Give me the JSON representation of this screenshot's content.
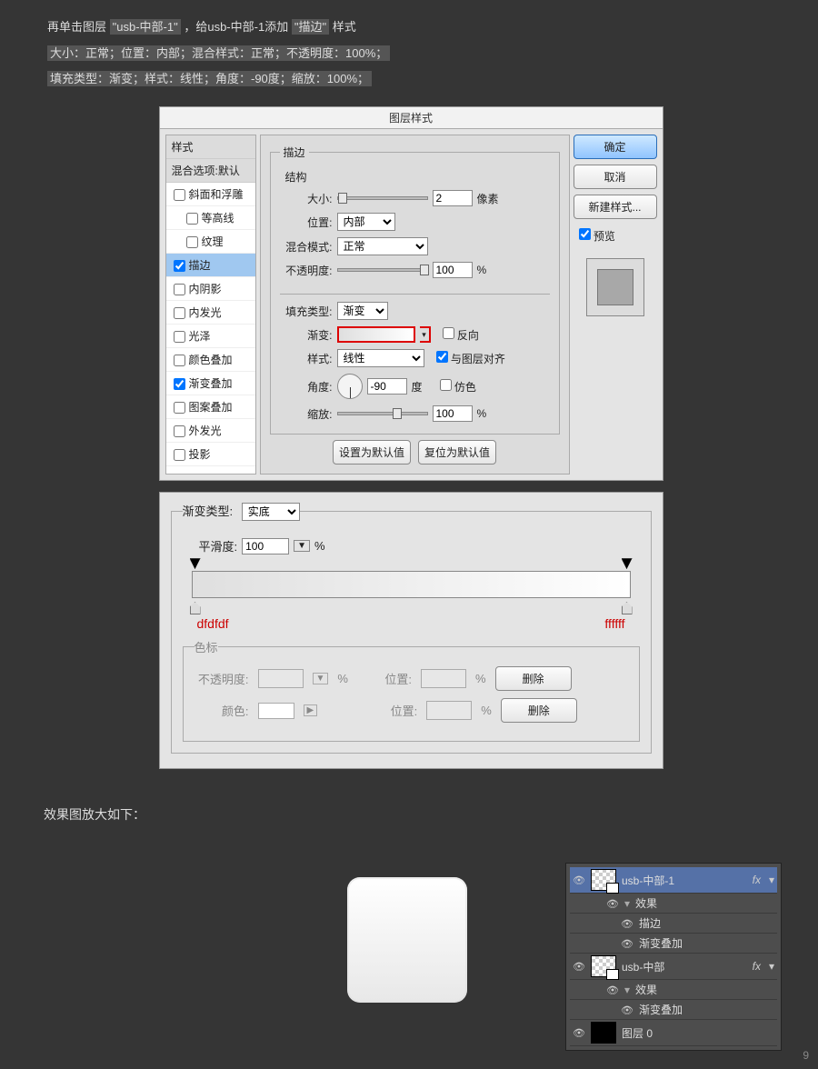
{
  "instructions": {
    "line1_a": "再单击图层",
    "line1_b": "\"usb-中部-1\"",
    "line1_c": "，给usb-中部-1添加",
    "line1_d": "\"描边\"",
    "line1_e": "样式",
    "line2": "大小：正常；位置：内部；混合样式：正常；不透明度：100%；",
    "line3": "填充类型：渐变；样式：线性；角度：-90度；缩放：100%；"
  },
  "dialog": {
    "title": "图层样式",
    "styles_header": "样式",
    "blend_header": "混合选项:默认",
    "style_items": [
      {
        "label": "斜面和浮雕",
        "checked": false,
        "indent": 0
      },
      {
        "label": "等高线",
        "checked": false,
        "indent": 1
      },
      {
        "label": "纹理",
        "checked": false,
        "indent": 1
      },
      {
        "label": "描边",
        "checked": true,
        "indent": 0,
        "selected": true
      },
      {
        "label": "内阴影",
        "checked": false,
        "indent": 0
      },
      {
        "label": "内发光",
        "checked": false,
        "indent": 0
      },
      {
        "label": "光泽",
        "checked": false,
        "indent": 0
      },
      {
        "label": "颜色叠加",
        "checked": false,
        "indent": 0
      },
      {
        "label": "渐变叠加",
        "checked": true,
        "indent": 0
      },
      {
        "label": "图案叠加",
        "checked": false,
        "indent": 0
      },
      {
        "label": "外发光",
        "checked": false,
        "indent": 0
      },
      {
        "label": "投影",
        "checked": false,
        "indent": 0
      }
    ],
    "stroke_legend": "描边",
    "struct_legend": "结构",
    "size_label": "大小:",
    "size_value": "2",
    "size_unit": "像素",
    "position_label": "位置:",
    "position_value": "内部",
    "blend_label": "混合模式:",
    "blend_value": "正常",
    "opacity_label": "不透明度:",
    "opacity_value": "100",
    "fill_label": "填充类型:",
    "fill_value": "渐变",
    "grad_label": "渐变:",
    "reverse_label": "反向",
    "style_label": "样式:",
    "style_value": "线性",
    "align_label": "与图层对齐",
    "angle_label": "角度:",
    "angle_value": "-90",
    "angle_unit": "度",
    "dither_label": "仿色",
    "scale_label": "缩放:",
    "scale_value": "100",
    "percent": "%",
    "set_default": "设置为默认值",
    "reset_default": "复位为默认值",
    "ok": "确定",
    "cancel": "取消",
    "new_style": "新建样式...",
    "preview_label": "预览"
  },
  "grad_editor": {
    "type_label": "渐变类型:",
    "type_value": "实底",
    "smooth_label": "平滑度:",
    "smooth_value": "100",
    "color_left": "dfdfdf",
    "color_right": "ffffff",
    "stops_legend": "色标",
    "opacity_label": "不透明度:",
    "position_label": "位置:",
    "delete_label": "删除",
    "color_label": "颜色:",
    "percent": "%"
  },
  "result_label": "效果图放大如下：",
  "layers": {
    "items": [
      {
        "name": "usb-中部-1",
        "fx": true,
        "selected": true,
        "thumb": "checker"
      },
      {
        "name": "效果",
        "sub": 1
      },
      {
        "name": "描边",
        "sub": 2
      },
      {
        "name": "渐变叠加",
        "sub": 2
      },
      {
        "name": "usb-中部",
        "fx": true,
        "thumb": "checker"
      },
      {
        "name": "效果",
        "sub": 1
      },
      {
        "name": "渐变叠加",
        "sub": 2
      },
      {
        "name": "图层 0",
        "thumb": "black"
      }
    ]
  },
  "page_number": "9"
}
